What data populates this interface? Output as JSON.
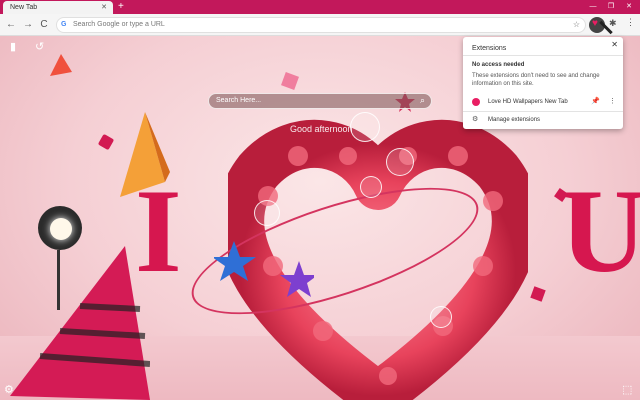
{
  "browser": {
    "tab_title": "New Tab",
    "tab_close": "✕",
    "new_tab": "+",
    "window_minimize": "—",
    "window_restore": "❐",
    "window_close": "✕",
    "back": "←",
    "forward": "→",
    "reload": "C",
    "omnibox_placeholder": "Search Google or type a URL",
    "omnibox_g": "G",
    "bookmark_star": "☆",
    "extension_heart": "♥",
    "puzzle": "✱",
    "menu": "⋮"
  },
  "new_tab_page": {
    "search_placeholder": "Search Here...",
    "search_icon": "⌕",
    "greeting": "Good afternoon",
    "letter_left": "I",
    "letter_right": "U",
    "bookmark_icon": "▮",
    "history_icon": "↺",
    "settings_icon": "⚙",
    "top_right_icon": "⬚"
  },
  "extensions_popup": {
    "title": "Extensions",
    "close": "✕",
    "heading": "No access needed",
    "description": "These extensions don't need to see and change information on this site.",
    "items": [
      {
        "label": "Love HD Wallpapers New Tab",
        "pin": "📌",
        "menu": "⋮"
      }
    ],
    "manage_icon": "⚙",
    "manage_label": "Manage extensions"
  },
  "colors": {
    "accent": "#d6174f",
    "tabstrip": "#c2185b",
    "pin": "#1a73e8"
  }
}
